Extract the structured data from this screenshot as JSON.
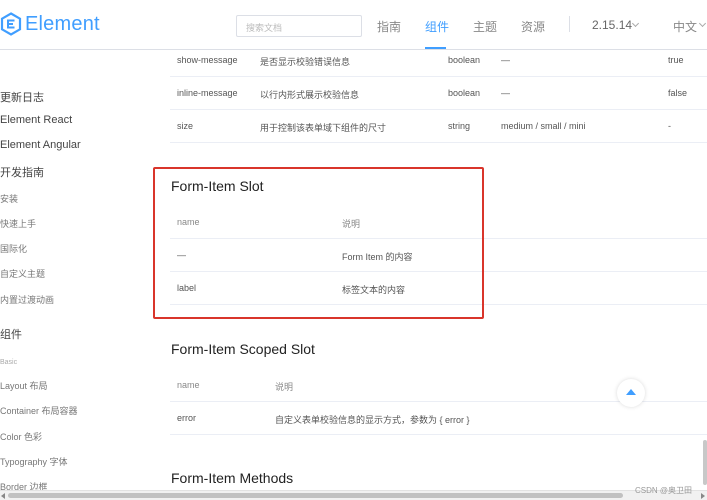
{
  "header": {
    "logo_text": "Element",
    "search_placeholder": "搜索文档",
    "nav": {
      "guide": "指南",
      "component": "组件",
      "theme": "主题",
      "resource": "资源"
    },
    "version": "2.15.14",
    "language": "中文"
  },
  "sidebar": {
    "changelog": "更新日志",
    "react": "Element React",
    "angular": "Element Angular",
    "dev_guide": "开发指南",
    "install": "安装",
    "quickstart": "快速上手",
    "i18n": "国际化",
    "custom_theme": "自定义主题",
    "transition": "内置过渡动画",
    "components": "组件",
    "basic": "Basic",
    "layout": "Layout 布局",
    "container": "Container 布局容器",
    "color": "Color 色彩",
    "typography": "Typography 字体",
    "border": "Border 边框"
  },
  "attributes_table": {
    "rows": [
      {
        "name": "show-message",
        "desc": "是否显示校验错误信息",
        "type": "boolean",
        "options": "—",
        "default": "true"
      },
      {
        "name": "inline-message",
        "desc": "以行内形式展示校验信息",
        "type": "boolean",
        "options": "—",
        "default": "false"
      },
      {
        "name": "size",
        "desc": "用于控制该表单域下组件的尺寸",
        "type": "string",
        "options": "medium / small / mini",
        "default": "-"
      }
    ]
  },
  "slot_section": {
    "title": "Form-Item Slot",
    "headers": {
      "name": "name",
      "desc": "说明"
    },
    "rows": [
      {
        "name": "—",
        "desc": "Form Item 的内容"
      },
      {
        "name": "label",
        "desc": "标签文本的内容"
      }
    ]
  },
  "scoped_slot_section": {
    "title": "Form-Item Scoped Slot",
    "headers": {
      "name": "name",
      "desc": "说明"
    },
    "rows": [
      {
        "name": "error",
        "desc": "自定义表单校验信息的显示方式，参数为 { error }"
      }
    ]
  },
  "methods_section": {
    "title": "Form-Item Methods"
  },
  "watermark": "CSDN @奥卫田",
  "colors": {
    "brand": "#409eff",
    "highlight_box": "#d9352b"
  }
}
